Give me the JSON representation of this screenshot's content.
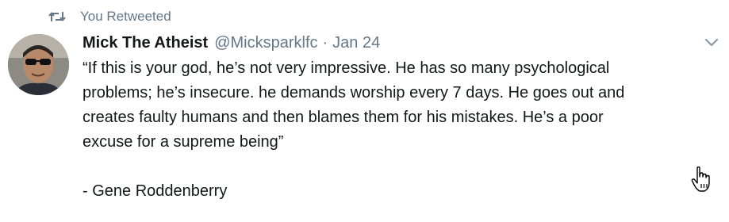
{
  "retweet_context": {
    "icon": "retweet-icon",
    "label": "You Retweeted"
  },
  "tweet": {
    "avatar": {
      "icon": "avatar",
      "alt": "Mick The Atheist"
    },
    "fullname": "Mick The Atheist",
    "username": "@Micksparklfc",
    "separator": "·",
    "timestamp": "Jan 24",
    "text": "“If this is your god, he’s not very impressive. He has so many psychological\nproblems; he’s insecure. he demands worship every 7 days. He goes out and\ncreates faulty humans and then blames them for his mistakes. He’s a poor\nexcuse for a supreme being”\n\n- Gene Roddenberry",
    "more_menu_icon": "chevron-down-icon"
  },
  "colors": {
    "text": "#14171a",
    "secondary_text": "#657786",
    "background": "#ffffff"
  },
  "cursor": {
    "icon": "hand-pointer-icon"
  }
}
